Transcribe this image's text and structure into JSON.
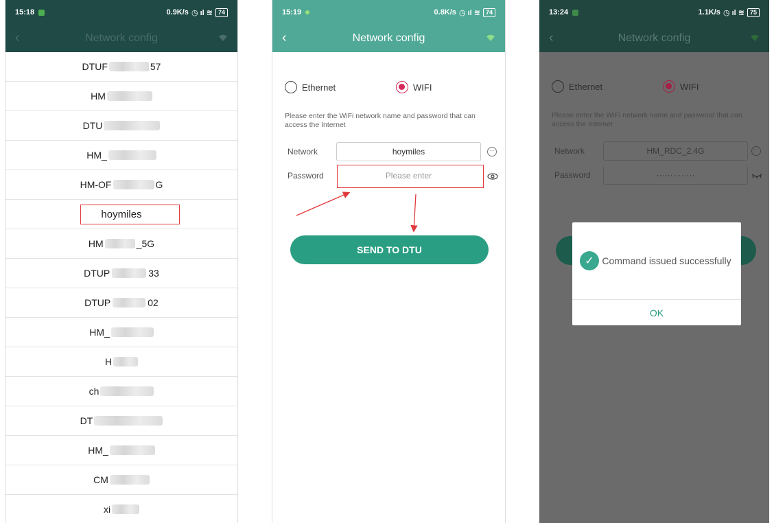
{
  "colors": {
    "accent": "#4fa996",
    "send_button": "#2a9e83",
    "radio_selected": "#d8285a",
    "annotation_red": "#e0393b"
  },
  "screen1": {
    "status": {
      "time": "15:18",
      "speed": "0.9K/s",
      "battery": "74"
    },
    "title": "Network config",
    "networks": [
      {
        "label": "DTUF",
        "suffix": "57"
      },
      {
        "label": "HM",
        "suffix": ""
      },
      {
        "label": "DTU",
        "suffix": ""
      },
      {
        "label": "HM_",
        "suffix": ""
      },
      {
        "label": "HM-OF",
        "suffix": "G"
      },
      {
        "label": "hoymiles",
        "suffix": ""
      },
      {
        "label": "HM",
        "suffix": "_5G"
      },
      {
        "label": "DTUP",
        "suffix": "33"
      },
      {
        "label": "DTUP",
        "suffix": "02"
      },
      {
        "label": "HM_",
        "suffix": ""
      },
      {
        "label": "H",
        "suffix": ""
      },
      {
        "label": "ch",
        "suffix": ""
      },
      {
        "label": "DT",
        "suffix": ""
      },
      {
        "label": "HM_",
        "suffix": ""
      },
      {
        "label": "CM",
        "suffix": ""
      },
      {
        "label": "xi",
        "suffix": ""
      }
    ]
  },
  "screen2": {
    "status": {
      "time": "15:19",
      "speed": "0.8K/s",
      "battery": "74"
    },
    "title": "Network config",
    "ethernet_label": "Ethernet",
    "wifi_label": "WIFI",
    "hint": "Please enter the WiFi network name and password that can access the Internet",
    "network_label": "Network",
    "network_value": "hoymiles",
    "password_label": "Password",
    "password_placeholder": "Please enter",
    "send_label": "SEND TO DTU"
  },
  "screen3": {
    "status": {
      "time": "13:24",
      "speed": "1.1K/s",
      "battery": "75"
    },
    "title": "Network config",
    "ethernet_label": "Ethernet",
    "wifi_label": "WIFI",
    "hint": "Please enter the WiFi network name and password that can access the Internet",
    "network_label": "Network",
    "network_value": "HM_RDC_2.4G",
    "password_label": "Password",
    "password_value": "··············",
    "dialog_message": "Command issued successfully",
    "dialog_ok": "OK"
  }
}
